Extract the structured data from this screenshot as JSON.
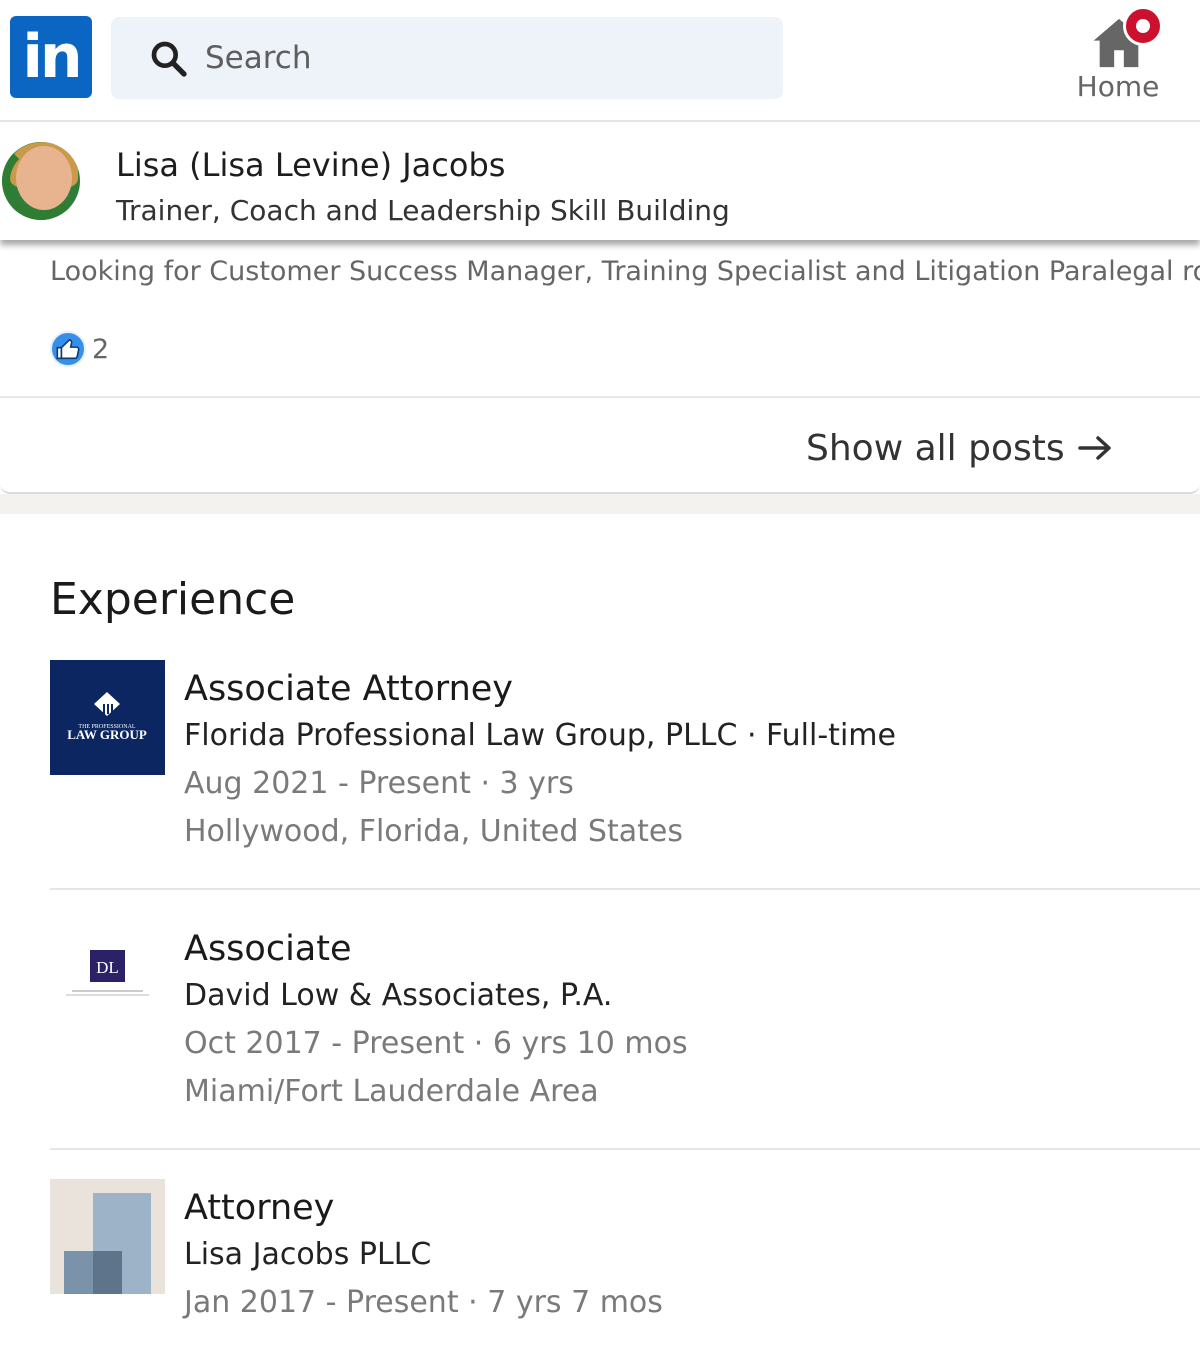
{
  "nav": {
    "logo_text": "in",
    "search_placeholder": "Search",
    "home_label": "Home",
    "brand_color": "#0a66c2",
    "notification_color": "#cb112d"
  },
  "profile": {
    "name": "Lisa (Lisa Levine) Jacobs",
    "headline": "Trainer, Coach and Leadership Skill Building"
  },
  "posts": {
    "snippet": "Looking for Customer Success Manager, Training Specialist and Litigation Paralegal roles",
    "reaction_count": "2",
    "show_all_label": "Show all posts"
  },
  "experience": {
    "title": "Experience",
    "items": [
      {
        "role": "Associate Attorney",
        "company": "Florida Professional Law Group, PLLC · Full-time",
        "dates": "Aug 2021 - Present · 3 yrs",
        "location": "Hollywood, Florida, United States",
        "logo_text_small": "THE PROFESSIONAL",
        "logo_text": "LAW GROUP"
      },
      {
        "role": "Associate",
        "company": "David Low & Associates, P.A.",
        "dates": "Oct 2017 - Present · 6 yrs 10 mos",
        "location": "Miami/Fort Lauderdale Area",
        "logo_text": "DL"
      },
      {
        "role": "Attorney",
        "company": "Lisa Jacobs PLLC",
        "dates": "Jan 2017 - Present · 7 yrs 7 mos"
      }
    ]
  }
}
